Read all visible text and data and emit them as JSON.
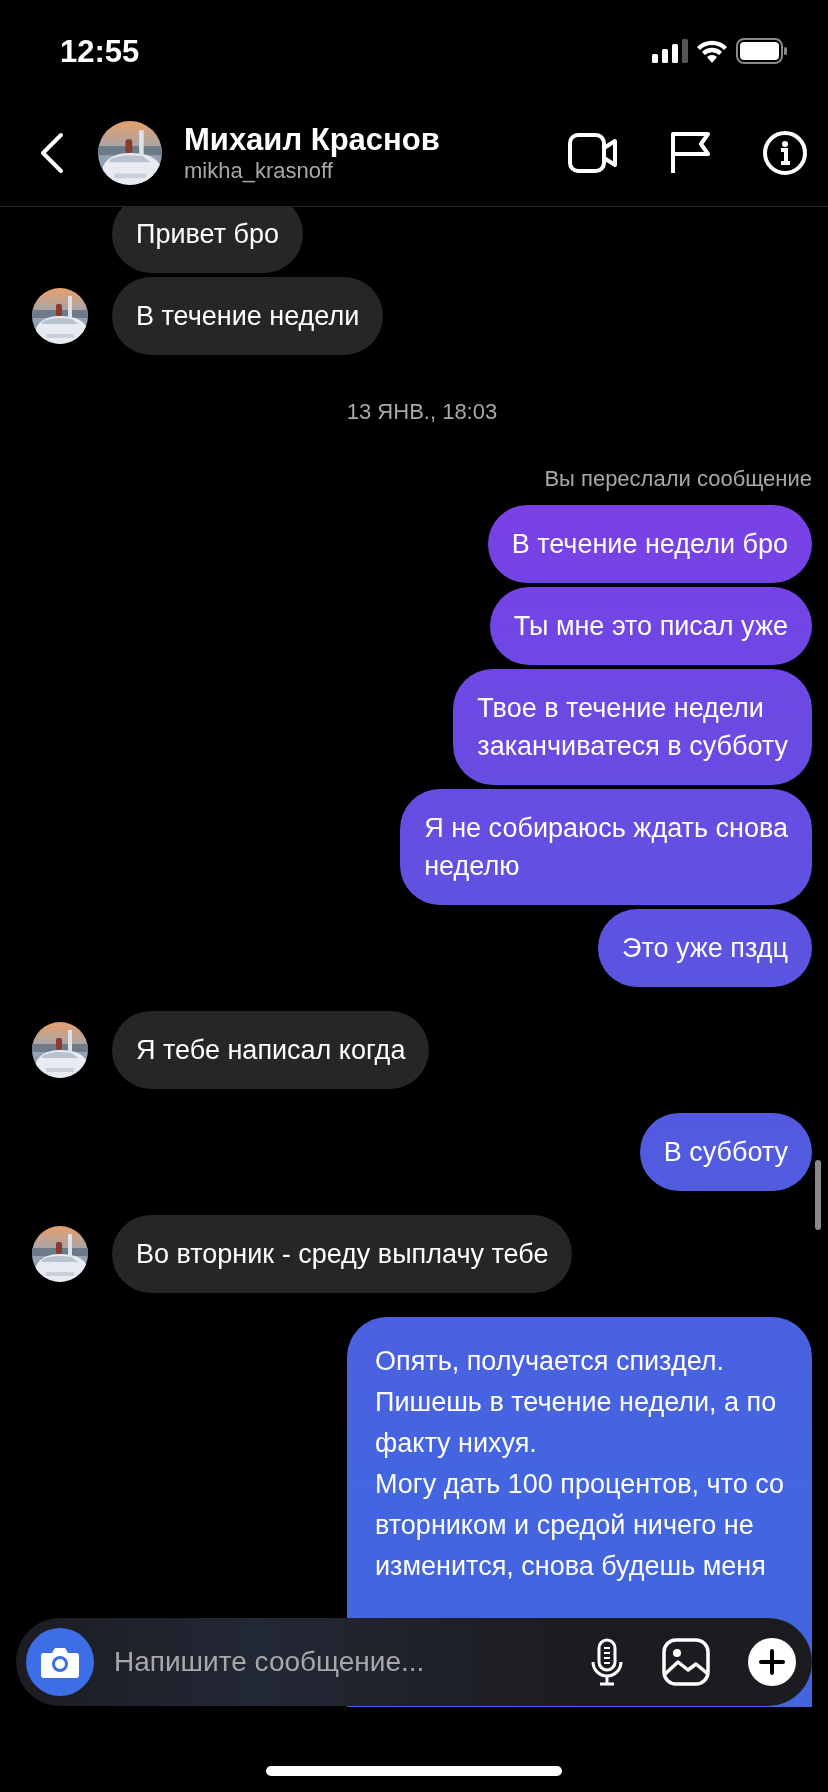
{
  "status_bar": {
    "time": "12:55"
  },
  "header": {
    "name": "Михаил Краснов",
    "username": "mikha_krasnoff"
  },
  "messages": [
    {
      "kind": "received",
      "text": "Привет бро",
      "avatar": false
    },
    {
      "kind": "received",
      "text": "В течение недели",
      "avatar": true
    },
    {
      "kind": "date",
      "text": "13 ЯНВ., 18:03"
    },
    {
      "kind": "note",
      "text": "Вы переслали сообщение"
    },
    {
      "kind": "sent",
      "text": "В течение недели бро"
    },
    {
      "kind": "sent",
      "text": "Ты мне это писал уже"
    },
    {
      "kind": "sent",
      "text": "Твое в течение недели\nзаканчиватеся в субботу"
    },
    {
      "kind": "sent",
      "text": "Я не собираюсь ждать снова\nнеделю"
    },
    {
      "kind": "sent",
      "text": "Это уже пздц"
    },
    {
      "kind": "received",
      "text": "Я тебе написал когда",
      "avatar": true
    },
    {
      "kind": "sent",
      "text": "В субботу"
    },
    {
      "kind": "received",
      "text": "Во вторник - среду выплачу тебе",
      "avatar": true
    },
    {
      "kind": "sent",
      "text": "Опять, получается спиздел.\nПишешь в течение недели, а по\nфакту нихуя.\nМогу дать 100 процентов, что со\nвторником и средой ничего не\nизменится, снова будешь меня"
    }
  ],
  "composer": {
    "placeholder": "Напишите сообщение..."
  }
}
